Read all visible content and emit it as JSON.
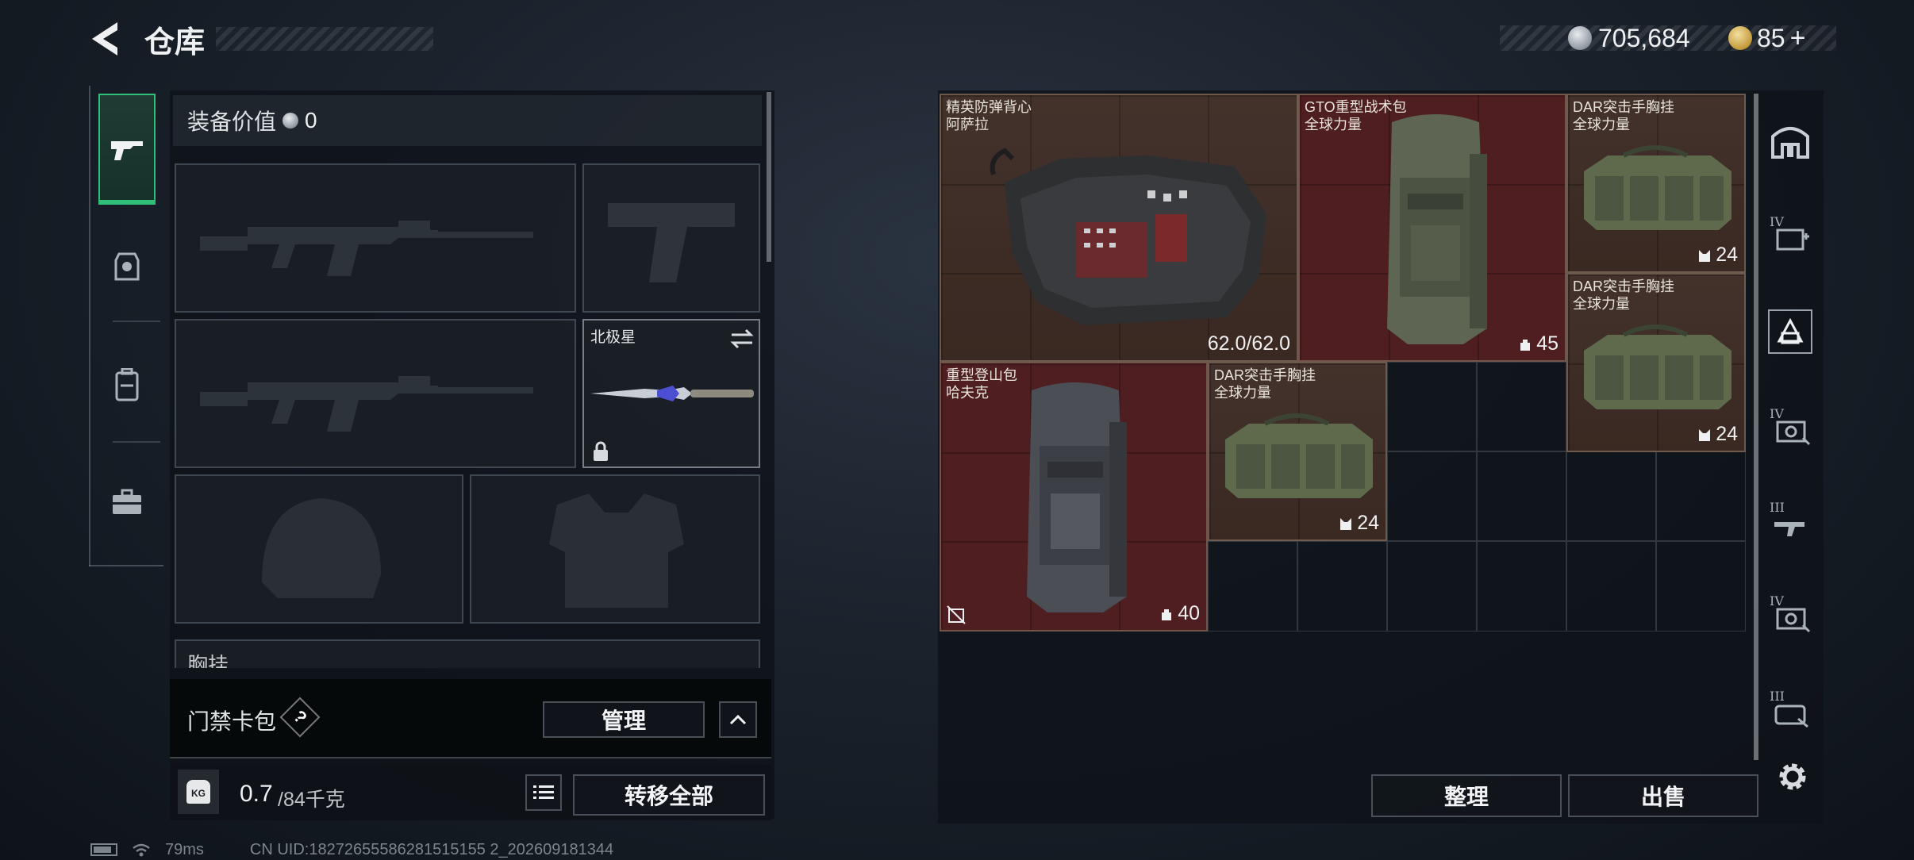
{
  "header": {
    "title": "仓库",
    "currency_amount": "705,684",
    "premium_amount": "85",
    "premium_plus": "+"
  },
  "left_panel": {
    "equipment_value_label": "装备价值",
    "equipment_value": "0",
    "melee_name": "北极星",
    "chest_rig_partial_label": "胸挂",
    "card_pack_label": "门禁卡包",
    "card_pack_help": "?",
    "manage_label": "管理",
    "weight_value": "0.7",
    "weight_capacity": "/84千克",
    "weight_icon_label": "KG",
    "transfer_all_label": "转移全部"
  },
  "stash": {
    "items": [
      {
        "name1": "精英防弹背心",
        "name2": "阿萨拉",
        "qty": "62.0/62.0"
      },
      {
        "name1": "GTO重型战术包",
        "name2": "全球力量",
        "qty": "45"
      },
      {
        "name1": "DAR突击手胸挂",
        "name2": "全球力量",
        "qty": "24"
      },
      {
        "name1": "DAR突击手胸挂",
        "name2": "全球力量",
        "qty": "24"
      },
      {
        "name1": "重型登山包",
        "name2": "哈夫克",
        "qty": "40"
      },
      {
        "name1": "DAR突击手胸挂",
        "name2": "全球力量",
        "qty": "24"
      }
    ],
    "sort_label": "整理",
    "sell_label": "出售",
    "side_icons": [
      "IV",
      "IV",
      "III",
      "IV",
      "III"
    ]
  },
  "status": {
    "ping": "79ms",
    "uid_text": "CN UID:18272655586281515155 2_202609181344"
  },
  "colors": {
    "brown_item": "#3d2b24",
    "red_item": "#4e1e21",
    "accent_green": "#2fbf7a"
  }
}
